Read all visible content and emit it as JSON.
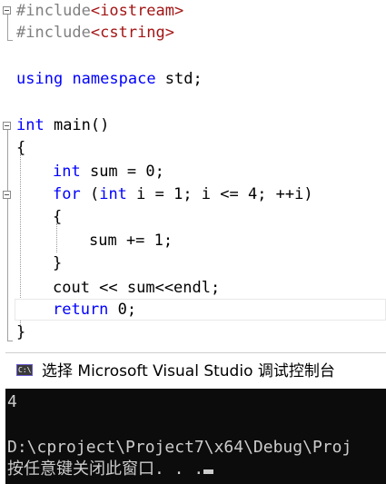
{
  "editor": {
    "lines": {
      "l1": {
        "pp": "#include",
        "str": "<iostream>"
      },
      "l2": {
        "pp": "#include",
        "str": "<cstring>"
      },
      "l4": {
        "kw1": "using",
        "kw2": "namespace",
        "rest": " std;"
      },
      "l6": {
        "kw": "int",
        "rest": " main()"
      },
      "l7": {
        "text": "{"
      },
      "l8": {
        "kw": "int",
        "rest": " sum = 0;"
      },
      "l9": {
        "kw1": "for",
        "kw2": "int",
        "rest": " i = 1; i <= 4; ++i)"
      },
      "l10": {
        "text": "{"
      },
      "l11": {
        "text": "sum += 1;"
      },
      "l12": {
        "text": "}"
      },
      "l13": {
        "text": "cout << sum<<endl;"
      },
      "l14": {
        "kw": "return",
        "rest": " 0;"
      },
      "l15": {
        "text": "}"
      }
    }
  },
  "console": {
    "title": "选择 Microsoft Visual Studio 调试控制台",
    "icon_label": "C:\\",
    "output": "4",
    "path_line": "D:\\cproject\\Project7\\x64\\Debug\\Proj",
    "prompt_line": "按任意键关闭此窗口. . ."
  }
}
